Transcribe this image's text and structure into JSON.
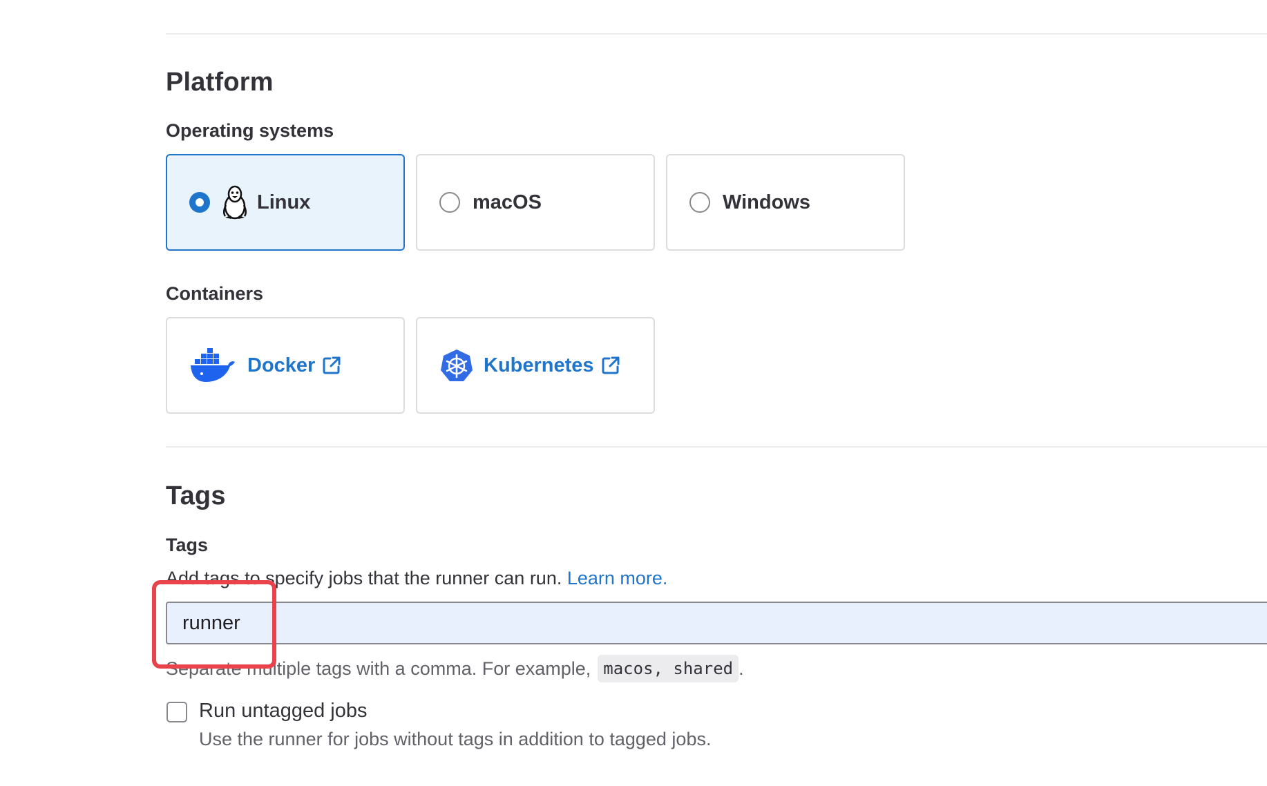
{
  "platform": {
    "title": "Platform",
    "os_label": "Operating systems",
    "os_options": [
      {
        "label": "Linux",
        "icon": "tux-penguin-icon",
        "selected": true
      },
      {
        "label": "macOS",
        "selected": false
      },
      {
        "label": "Windows",
        "selected": false
      }
    ],
    "containers_label": "Containers",
    "containers": [
      {
        "label": "Docker",
        "icon": "docker-whale-icon"
      },
      {
        "label": "Kubernetes",
        "icon": "kubernetes-helm-icon"
      }
    ]
  },
  "tags": {
    "title": "Tags",
    "field_label": "Tags",
    "help_text": "Add tags to specify jobs that the runner can run.",
    "learn_more": "Learn more.",
    "input_value": "runner",
    "hint_text": "Separate multiple tags with a comma. For example,",
    "hint_code": "macos, shared",
    "hint_end": ".",
    "untagged_label": "Run untagged jobs",
    "untagged_help": "Use the runner for jobs without tags in addition to tagged jobs."
  },
  "colors": {
    "accent": "#1f75cb",
    "selected_bg": "#e9f3fc",
    "input_bg": "#e8f0fe",
    "annotation_red": "#e8424a"
  }
}
